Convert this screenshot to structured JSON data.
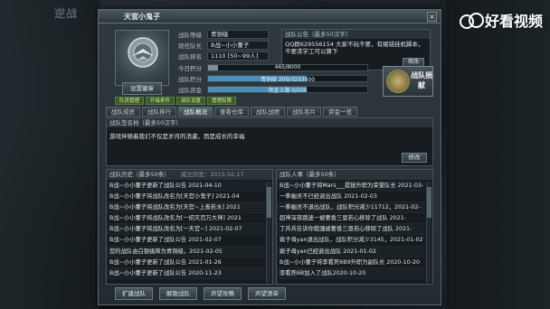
{
  "window": {
    "title": "天官小鬼子",
    "close": "×"
  },
  "watermark": {
    "text": "好看视频"
  },
  "background": {
    "logo_text": "逆战"
  },
  "avatar": {
    "button": "设置徽章"
  },
  "info": [
    {
      "label": "战队等级",
      "value": "青铜级"
    },
    {
      "label": "现任队长",
      "value": "B战~小小董子"
    },
    {
      "label": "战队排名",
      "value": "1110 [50~99人]"
    }
  ],
  "notice": {
    "header": "战队公告（最多50汉字）",
    "body": "QQ群629556154  大家不玩不要，有赌错挂机脚本，不要求学工可以算下",
    "edit": "修改"
  },
  "stats": [
    {
      "label": "今日积分",
      "text": "465/8000",
      "fill": 0.06,
      "color": "#7e8f95"
    },
    {
      "label": "战队积分",
      "text": "青铜级 209/3233000",
      "fill": 0.62,
      "color": "#4b8fb8"
    },
    {
      "label": "战队资金",
      "text": "资金上限 0/200",
      "fill": 0.62,
      "color": "#4b8fb8"
    }
  ],
  "donate": {
    "label": "战队捐献"
  },
  "tabs_top": [
    "队员管理",
    "升级条件",
    "战队设置",
    "管理权限"
  ],
  "tabs_main": [
    "战队成员",
    "战队排行",
    "战队概况",
    "查看仓库",
    "战队战绩",
    "战队名片",
    "资金一览"
  ],
  "active_tab": 2,
  "sign": {
    "header": "战队签名档（最多50汉字）",
    "body": "游戏伴随着我们不仅是岁月的消遣，而是成长的幸福",
    "edit": "修改"
  },
  "history": {
    "header": "战队历史（最多50条）",
    "founded": "成立历史：2015.02.17",
    "items": [
      "B战~小小董子更新了战队公告 2021-04-10",
      "B战~小小董子将战队改名为[天官小鬼子] 2021-04",
      "B战~小小董子将战队改名为[天官~上善若水] 2021",
      "B战~小小董子将战队改名为[一招灭百万大神] 2021",
      "B战~小小董子将战队改名为[一天官~] 2021-02-07",
      "B战~小小董子更新了战队公告 2021-02-07",
      "您的战队由白银级降为青铜级，2021-02-05",
      "B战~小小董子更新了战队公告 2021-01-26",
      "B战~小小董子更新了战队公告 2020-11-23"
    ]
  },
  "personnel": {
    "header": "战队人事（最多50条）",
    "items": [
      "B战~小小董子将Mars___提拔升职为荣誉队长 2021-03-",
      "一拳幽灵不已经退出战队 2021-02-03",
      "一拳幽灵不退出战队，战队积分减少11712，2021-02-",
      "超神深夜跳速一被奢香三恩若心移除了战队 2021-",
      "丁兵兵告诉你我骚被奢香三恩若心移除了战队 2021-",
      "疯子母yan退出战队，战队积分减少3145，2021-01-02",
      "疯子母yan已经退出战队 2021-01-02",
      "B战~小小董子将李看死6B9升职为副队长 2020-10-20",
      "李看死6B加入了战队2020-10-20"
    ]
  },
  "bottom_buttons": [
    "扩建战队",
    "解散战队",
    "声望攻略",
    "声望清单"
  ]
}
